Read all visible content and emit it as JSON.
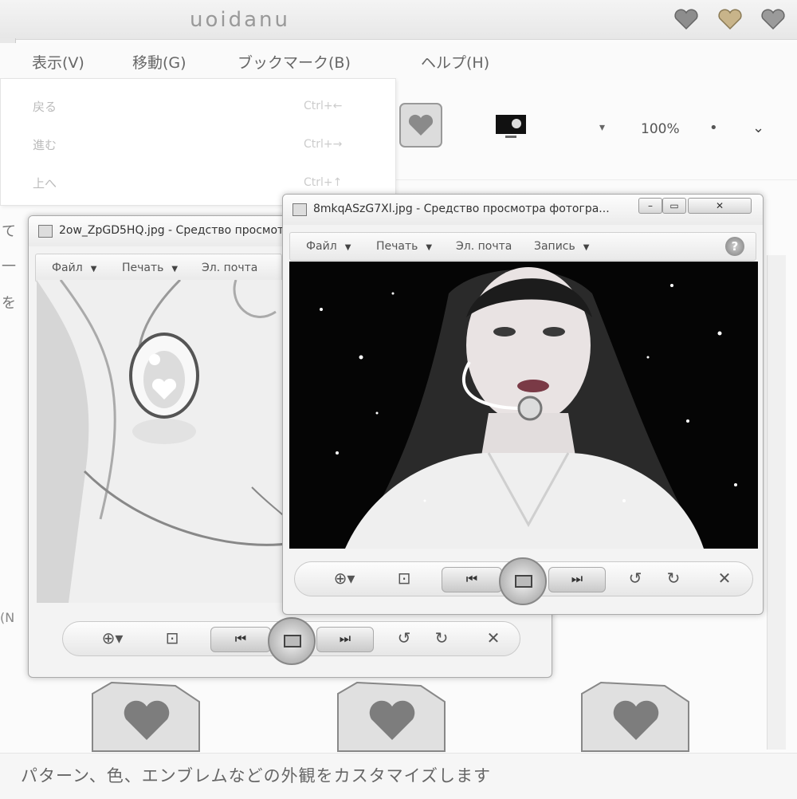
{
  "background_window": {
    "title": "uoidanu",
    "menu": [
      {
        "label": "表示(V)"
      },
      {
        "label": "移動(G)"
      },
      {
        "label": "ブックマーク(B)"
      },
      {
        "label": "ヘルプ(H)"
      }
    ],
    "toolbar": {
      "zoom_label": "100%"
    },
    "dropdown": [
      {
        "label": "戻る",
        "shortcut": "Ctrl+←"
      },
      {
        "label": "進む",
        "shortcut": "Ctrl+→"
      },
      {
        "label": "上へ",
        "shortcut": "Ctrl+↑"
      }
    ],
    "left_chars": [
      "て",
      "一",
      "を",
      "」"
    ],
    "bottom_left_text": "(N",
    "status_text": "パターン、色、エンブレムなどの外観をカスタマイズします"
  },
  "viewer_back": {
    "title": "2ow_ZpGD5HQ.jpg - Средство просмотра фотографий",
    "menu": [
      {
        "label": "Файл"
      },
      {
        "label": "Печать"
      },
      {
        "label": "Эл. почта"
      }
    ]
  },
  "viewer_front": {
    "title": "8mkqASzG7Xl.jpg - Средство просмотра фотогра...",
    "menu": [
      {
        "label": "Файл"
      },
      {
        "label": "Печать"
      },
      {
        "label": "Эл. почта"
      },
      {
        "label": "Запись"
      }
    ],
    "help": "?"
  },
  "controls": {
    "zoom": "⊕▾",
    "fit": "⊡",
    "prev": "⏮",
    "next": "⏭",
    "rotate_ccw": "↺",
    "rotate_cw": "↻",
    "delete": "✕"
  },
  "colors": {
    "accent_heart": "#8d8d8d",
    "heart_gold": "#c8b48a",
    "photo_bg": "#050505"
  }
}
